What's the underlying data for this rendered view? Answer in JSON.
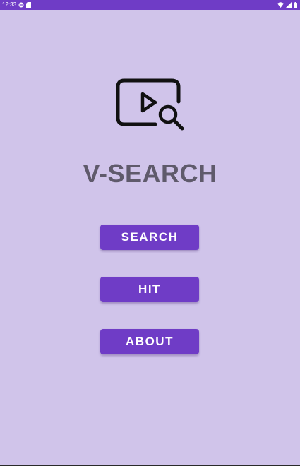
{
  "status_bar": {
    "time": "12:33",
    "left_icons": [
      "do-not-disturb-icon",
      "sd-card-icon"
    ],
    "right_icons": [
      "wifi-icon",
      "cellular-signal-icon",
      "battery-icon"
    ],
    "color": "#6f3cc6"
  },
  "app": {
    "logo_icon": "video-search-icon",
    "title": "V-SEARCH",
    "title_color": "#5f5a6b",
    "background": "#d0c4ea"
  },
  "buttons": {
    "search_label": "SEARCH",
    "hit_label": "HIT",
    "about_label": "ABOUT",
    "color": "#6f3cc6"
  }
}
